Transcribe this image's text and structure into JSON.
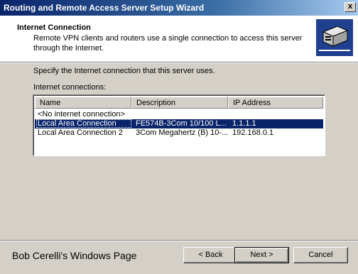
{
  "window": {
    "title": "Routing and Remote Access Server Setup Wizard",
    "close_glyph": "x"
  },
  "header": {
    "title": "Internet Connection",
    "subtitle": "Remote VPN clients and routers use a single connection to access this server through the Internet.",
    "icon": "network-server-icon"
  },
  "main": {
    "prompt": "Specify the Internet connection that this server uses.",
    "list_label": "Internet connections:",
    "columns": [
      "Name",
      "Description",
      "IP Address"
    ],
    "rows": [
      {
        "name": "<No internet connection>",
        "description": "",
        "ip": "",
        "selected": false
      },
      {
        "name": "Local Area Connection",
        "description": "FE574B-3Com 10/100 L...",
        "ip": "1.1.1.1",
        "selected": true
      },
      {
        "name": "Local Area Connection 2",
        "description": "3Com Megahertz (B) 10-...",
        "ip": "192.168.0.1",
        "selected": false
      }
    ]
  },
  "footer": {
    "text": "Bob Cerelli's Windows Page",
    "back_label": "< Back",
    "next_label": "Next >",
    "cancel_label": "Cancel"
  },
  "colors": {
    "selection": "#0a246a",
    "titlebar": "#0a246a",
    "dialog": "#d4d0c8"
  }
}
